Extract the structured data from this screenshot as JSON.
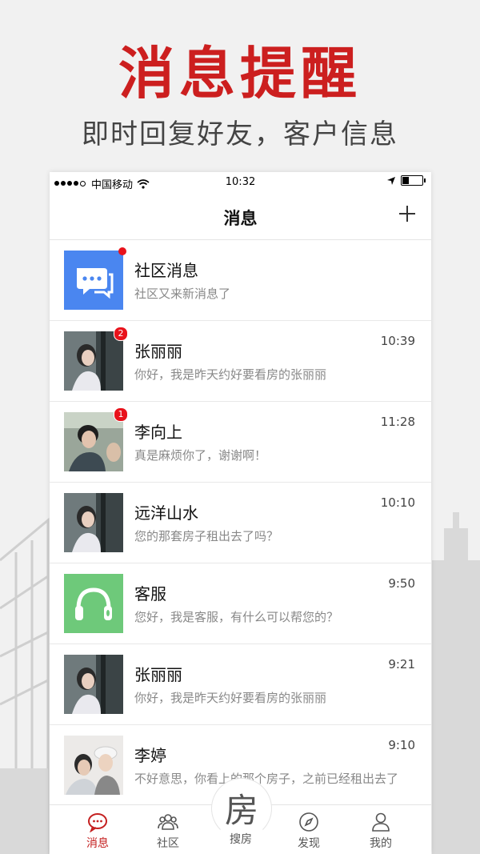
{
  "promo": {
    "title": "消息提醒",
    "subtitle": "即时回复好友，客户信息"
  },
  "statusbar": {
    "carrier": "中国移动",
    "time": "10:32"
  },
  "header": {
    "title": "消息",
    "add_icon": "plus-icon"
  },
  "messages": [
    {
      "name": "社区消息",
      "preview": "社区又来新消息了",
      "time": "",
      "badge": "",
      "dot": true,
      "avatar": "community-chat-icon"
    },
    {
      "name": "张丽丽",
      "preview": "你好，我是昨天约好要看房的张丽丽",
      "time": "10:39",
      "badge": "2",
      "avatar": "photo-avatar"
    },
    {
      "name": "李向上",
      "preview": "真是麻烦你了，谢谢啊！",
      "time": "11:28",
      "badge": "1",
      "avatar": "photo-avatar"
    },
    {
      "name": "远洋山水",
      "preview": "您的那套房子租出去了吗？",
      "time": "10:10",
      "badge": "",
      "avatar": "photo-avatar"
    },
    {
      "name": "客服",
      "preview": "您好，我是客服，有什么可以帮您的？",
      "time": "9:50",
      "badge": "",
      "avatar": "headset-icon"
    },
    {
      "name": "张丽丽",
      "preview": "你好，我是昨天约好要看房的张丽丽",
      "time": "9:21",
      "badge": "",
      "avatar": "photo-avatar"
    },
    {
      "name": "李婷",
      "preview": "不好意思，你看上的那个房子，之前已经租出去了",
      "time": "9:10",
      "badge": "",
      "avatar": "photo-avatar"
    }
  ],
  "tabs": [
    {
      "label": "消息",
      "icon": "chat-icon",
      "active": true
    },
    {
      "label": "社区",
      "icon": "group-icon"
    },
    {
      "label": "搜房",
      "icon": "house-search-icon",
      "glyph": "房"
    },
    {
      "label": "发现",
      "icon": "compass-icon"
    },
    {
      "label": "我的",
      "icon": "person-icon"
    }
  ],
  "colors": {
    "brand_red": "#cc1f1f",
    "badge_red": "#e8121b",
    "community_blue": "#4a86f0",
    "service_green": "#6ec97a"
  }
}
